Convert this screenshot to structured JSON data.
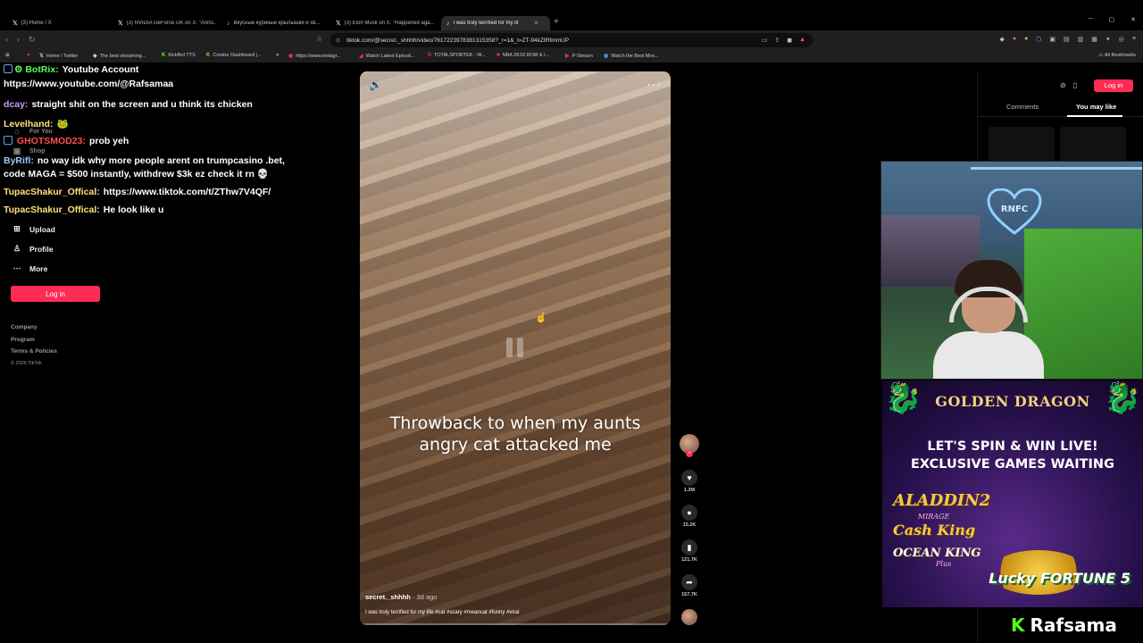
{
  "browser": {
    "tabs": [
      {
        "icon": "x-logo",
        "label": "(3) Home / X"
      },
      {
        "icon": "x-logo",
        "label": "(3) NVIDIA GeForce UK on X: \"Anno..."
      },
      {
        "icon": "tiktok-logo",
        "label": "Вкусные куриные крылышки и хв..."
      },
      {
        "icon": "x-logo",
        "label": "(3) Elon Musk on X: \"Happened aga..."
      },
      {
        "icon": "tiktok-logo",
        "label": "I was truly terrified for my lif"
      }
    ],
    "active_tab": 4,
    "url": "tiktok.com/@secret._shhhh/video/7617223978381315358?_r=1&_t=ZT-94kZtRfmmUP",
    "bookmarks": [
      "Home / Twitter",
      "The best streaming...",
      "KickBot TTS",
      "Creator Dashboard |...",
      "https://www.instagr...",
      "Watch Latest Episod...",
      "TOTALSPORTEK - W...",
      "NBA 2K18 ROM & I...",
      "P-Stream",
      "Watch the Best Mov..."
    ],
    "all_bookmarks": "All Bookmarks"
  },
  "chat": [
    {
      "user": "BotRix:",
      "user_color": "#5dfc5d",
      "text": "Youtube Account"
    },
    {
      "user": "",
      "user_color": "#ffffff",
      "text": "https://www.youtube.com/@Rafsamaa"
    },
    {
      "user": "dcay:",
      "user_color": "#c8a0ff",
      "text": "straight shit on the screen and u think its chicken"
    },
    {
      "user": "Levelhand:",
      "user_color": "#ffe27a",
      "text": ""
    },
    {
      "user": "GHOTSMOD23:",
      "user_color": "#ff4d4d",
      "text": "prob yeh"
    },
    {
      "user": "ByRifl:",
      "user_color": "#a0c8ff",
      "text": "no way idk why more people arent on trumpcasino .bet, code MAGA = $500 instantly, withdrew $3k ez check it rn 💀"
    },
    {
      "user": "TupacShakur_Offical:",
      "user_color": "#ffe27a",
      "text": "https://www.tiktok.com/t/ZThw7V4QF/"
    },
    {
      "user": "TupacShakur_Offical:",
      "user_color": "#ffe27a",
      "text": "He look like u"
    }
  ],
  "sidebar": {
    "for_you": "For You",
    "shop": "Shop",
    "upload": "Upload",
    "profile": "Profile",
    "more": "More",
    "login": "Log in",
    "footer": [
      "Company",
      "Program",
      "Terms & Policies"
    ],
    "copyright": "© 2026 TikTok"
  },
  "video": {
    "caption": "Throwback to when my aunts angry cat attacked me",
    "author": "secret._shhhh",
    "posted": "· 3d ago",
    "description": "I was truly terrified for my life #cat #scary #meancat #funny #viral",
    "likes": "1.2M",
    "comments": "15.2K",
    "saves": "121.7K",
    "shares": "157.7K"
  },
  "right_panel": {
    "login": "Log in",
    "tabs": [
      "Comments",
      "You may like"
    ],
    "active_tab": "You may like"
  },
  "webcam": {
    "sign_text": "RNFC"
  },
  "ad": {
    "brand": "GOLDEN DRAGON",
    "headline_1": "LET'S SPIN & WIN LIVE!",
    "headline_2": "EXCLUSIVE GAMES WAITING",
    "game_1": "ALADDIN2",
    "game_1_sub": "MIRAGE",
    "game_2": "Cash King",
    "game_3": "OCEAN KING",
    "game_3_sub": "Plus",
    "game_4": "Lucky FORTUNE 5"
  },
  "streamer": {
    "platform_icon": "kick-logo",
    "name": "Rafsama"
  }
}
